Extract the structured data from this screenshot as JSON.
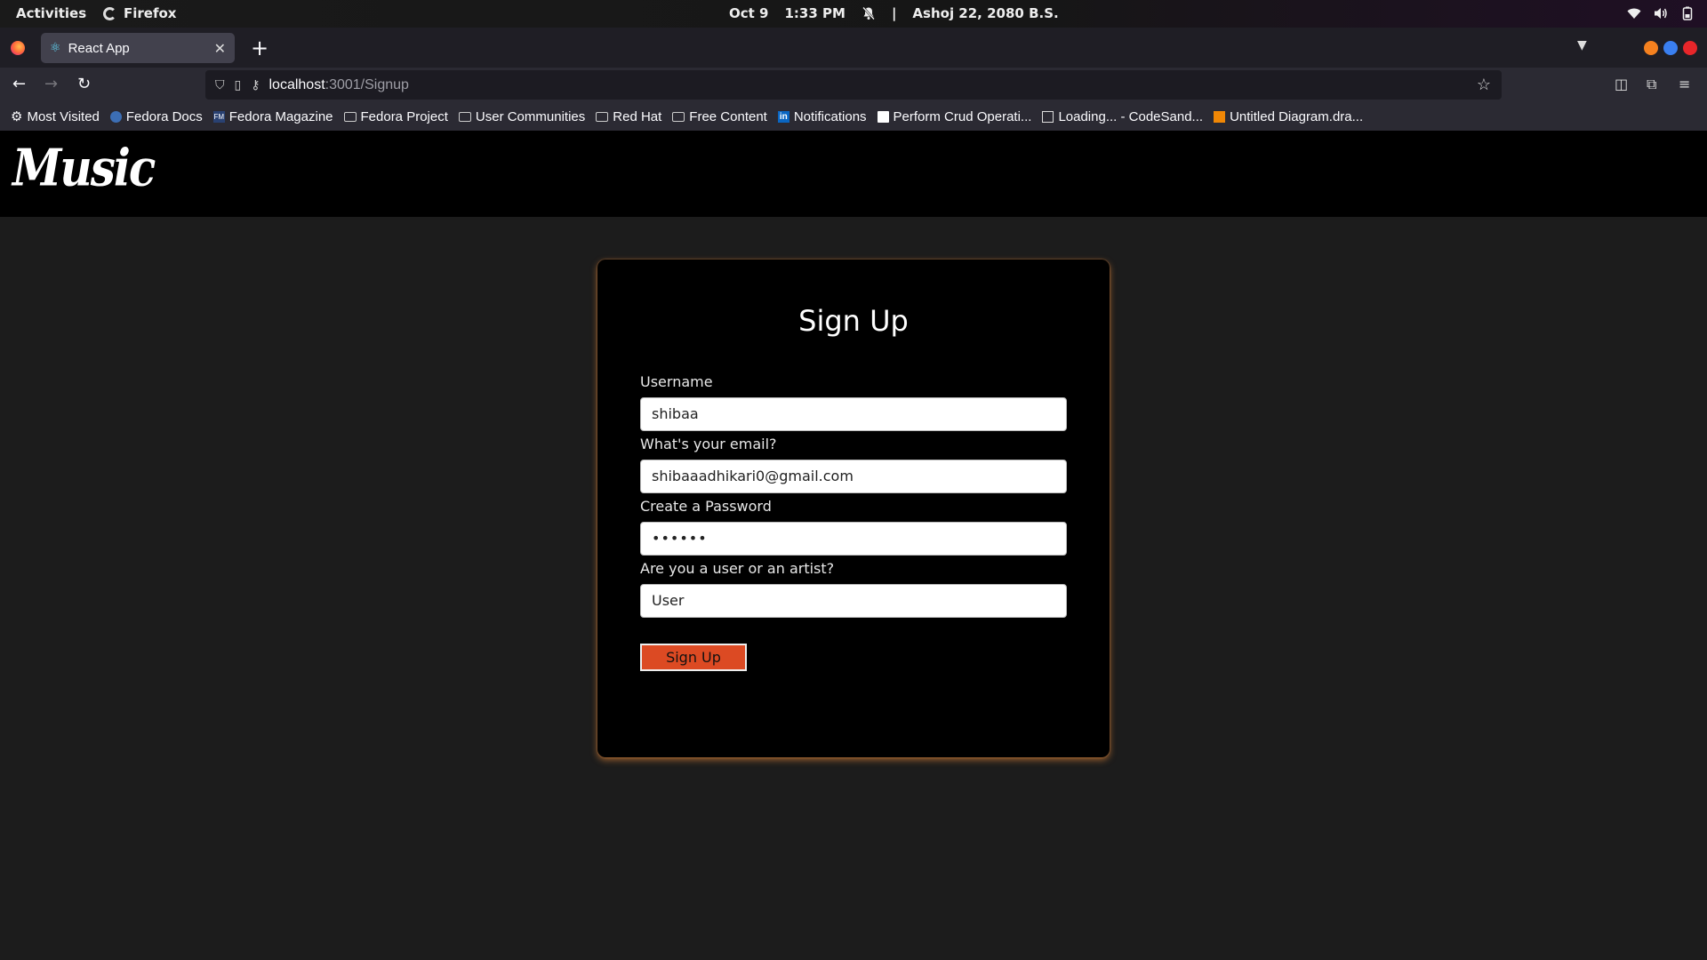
{
  "system": {
    "activities": "Activities",
    "app_name": "Firefox",
    "date": "Oct 9",
    "time": "1:33 PM",
    "separator": "|",
    "alt_date": "Ashoj 22, 2080 B.S."
  },
  "browser": {
    "tab_title": "React App",
    "url_host": "localhost",
    "url_path": ":3001/Signup",
    "bookmarks": [
      {
        "label": "Most Visited",
        "icon": "gear-icon"
      },
      {
        "label": "Fedora Docs",
        "icon": "fedora-icon"
      },
      {
        "label": "Fedora Magazine",
        "icon": "fm-icon"
      },
      {
        "label": "Fedora Project",
        "icon": "folder-icon"
      },
      {
        "label": "User Communities",
        "icon": "folder-icon"
      },
      {
        "label": "Red Hat",
        "icon": "folder-icon"
      },
      {
        "label": "Free Content",
        "icon": "folder-icon"
      },
      {
        "label": "Notifications",
        "icon": "linkedin-icon"
      },
      {
        "label": "Perform Crud Operati...",
        "icon": "page-icon"
      },
      {
        "label": "Loading... - CodeSand...",
        "icon": "codesandbox-icon"
      },
      {
        "label": "Untitled Diagram.dra...",
        "icon": "drawio-icon"
      }
    ]
  },
  "site": {
    "logo_text": "Music"
  },
  "form": {
    "title": "Sign Up",
    "username_label": "Username",
    "username_value": "shibaa",
    "email_label": "What's your email?",
    "email_value": "shibaaadhikari0@gmail.com",
    "password_label": "Create a Password",
    "password_value": "••••••",
    "role_label": "Are you a user or an artist?",
    "role_value": "User",
    "submit_label": "Sign Up"
  },
  "colors": {
    "accent": "#dc4a23",
    "card_glow": "#ff963c",
    "header_bg": "#000000",
    "page_bg": "#1c1c1c"
  }
}
